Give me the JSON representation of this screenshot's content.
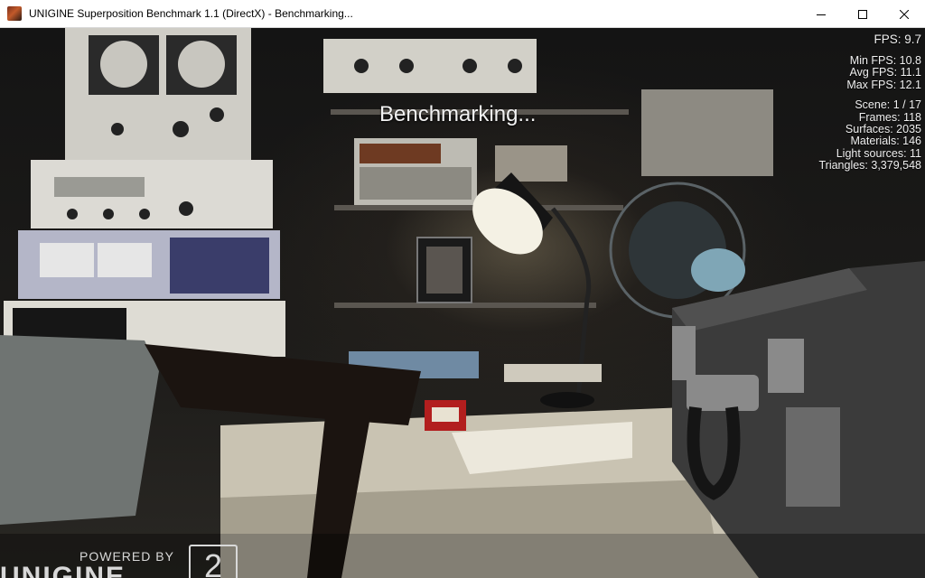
{
  "window": {
    "title": "UNIGINE Superposition Benchmark 1.1 (DirectX) - Benchmarking...",
    "icons": {
      "app": "unigine-app-icon",
      "minimize": "minimize-icon",
      "maximize": "maximize-icon",
      "close": "close-icon"
    }
  },
  "overlay": {
    "status": "Benchmarking...",
    "fps": "FPS: 9.7",
    "min_fps": "Min FPS: 10.8",
    "avg_fps": "Avg FPS: 11.1",
    "max_fps": "Max FPS: 12.1",
    "scene": "Scene: 1 / 17",
    "frames": "Frames: 118",
    "surfaces": "Surfaces: 2035",
    "materials": "Materials: 146",
    "light_sources": "Light sources: 11",
    "triangles": "Triangles: 3,379,548"
  },
  "logo": {
    "powered_by": "POWERED BY",
    "brand": "UNIGINE",
    "version_mark": "2"
  }
}
